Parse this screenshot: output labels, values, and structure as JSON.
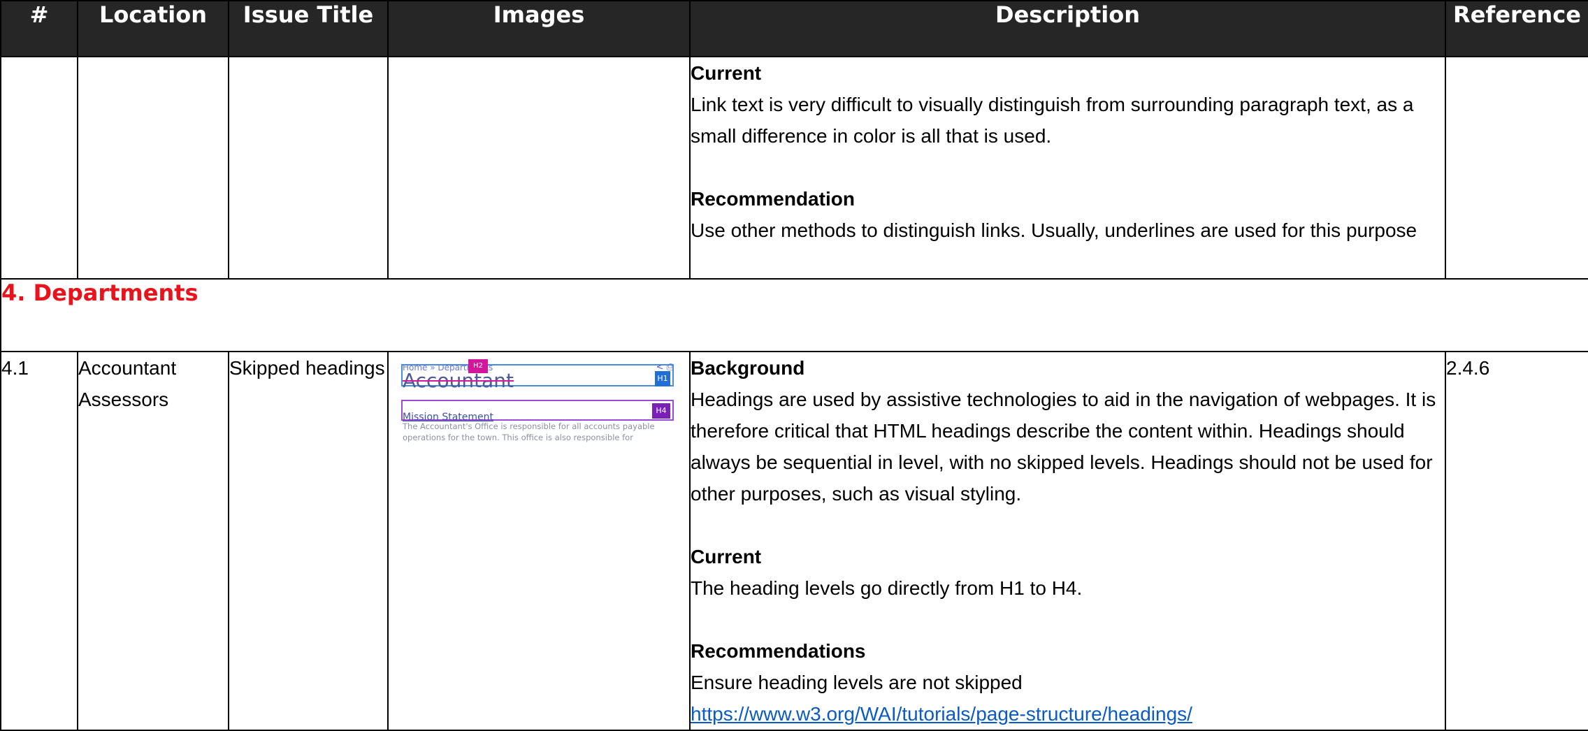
{
  "table": {
    "headers": [
      "#",
      "Location",
      "Issue Title",
      "Images",
      "Description",
      "Reference"
    ]
  },
  "row_prev": {
    "current_heading": "Current",
    "current_text": "Link text is very difficult to visually distinguish from surrounding paragraph text, as a small difference in color is all that is used.",
    "recommendation_heading": "Recommendation",
    "recommendation_text": "Use other methods to distinguish links. Usually, underlines are used for this purpose"
  },
  "section": {
    "title": "4. Departments"
  },
  "row_41": {
    "number": "4.1",
    "location": "Accountant Assessors",
    "issue_title": "Skipped headings",
    "background_heading": "Background",
    "background_text": "Headings are used by assistive technologies to aid in the navigation of webpages. It is therefore critical that HTML headings describe the content within. Headings should always be sequential in level, with no skipped levels. Headings should not be used for other purposes, such as visual styling.",
    "current_heading": "Current",
    "current_text": "The heading levels go directly from H1 to H4.",
    "recommendations_heading": "Recommendations",
    "recommendations_text": "Ensure heading levels are not skipped",
    "link": "https://www.w3.org/WAI/tutorials/page-structure/headings/",
    "reference": "2.4.6",
    "thumbnail": {
      "breadcrumb": "Home » Departments",
      "heading_text": "Accountant",
      "h1_badge": "H1",
      "h2_badge": "H2",
      "subheading_text": "Mission Statement",
      "h4_badge": "H4",
      "paragraph": "The Accountant's Office is responsible for all accounts payable operations for the town. This office is also responsible for monitoring"
    }
  }
}
